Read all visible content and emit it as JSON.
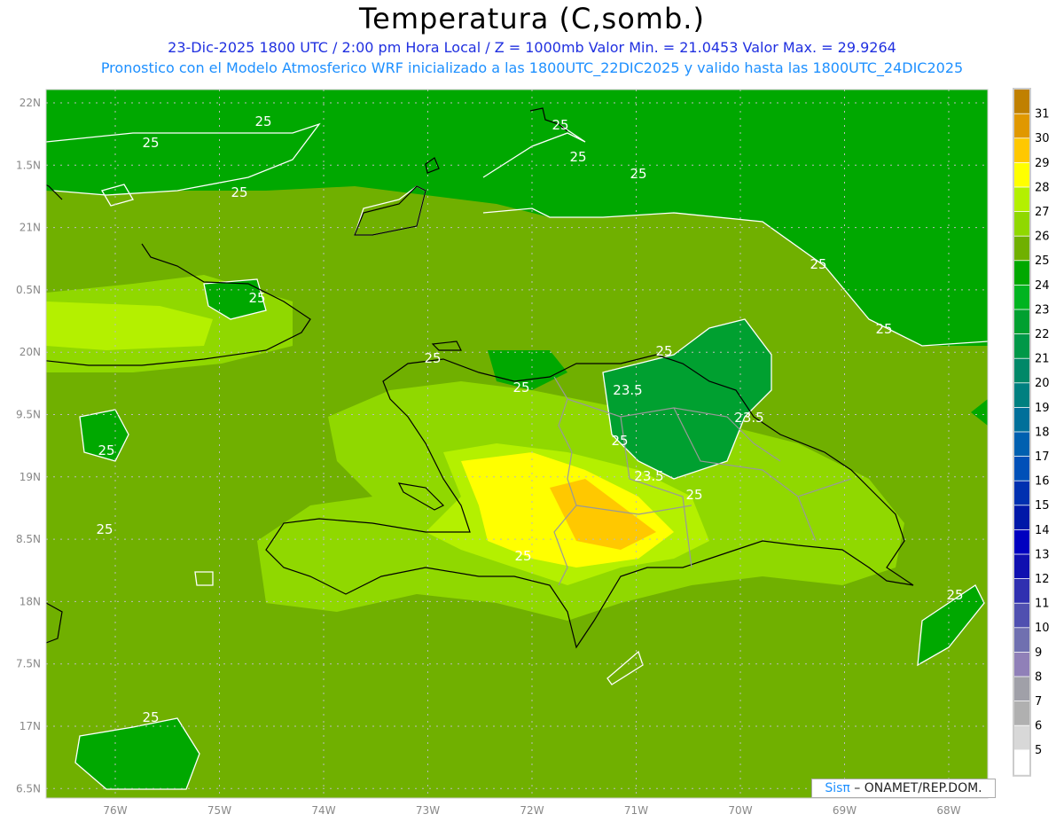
{
  "header": {
    "title": "Temperatura (C,somb.)",
    "subtitle_line1": "23-Dic-2025  1800 UTC / 2:00 pm Hora Local / Z = 1000mb   Valor Min. = 21.0453  Valor Max. = 29.9264",
    "subtitle_line2": "Pronostico con el Modelo Atmosferico WRF inicializado a las 1800UTC_22DIC2025 y valido hasta las  1800UTC_24DIC2025"
  },
  "axes": {
    "lon_labels": [
      "76W",
      "75W",
      "74W",
      "73W",
      "72W",
      "71W",
      "70W",
      "69W",
      "68W"
    ],
    "lat_labels": [
      "22N",
      "1.5N",
      "21N",
      "0.5N",
      "20N",
      "9.5N",
      "19N",
      "8.5N",
      "18N",
      "7.5N",
      "17N",
      "6.5N"
    ]
  },
  "contour_labels": [
    "25",
    "25",
    "25",
    "25",
    "25",
    "25",
    "25",
    "25",
    "25",
    "25",
    "25",
    "25",
    "25",
    "23.5",
    "23.5",
    "23.5",
    "25",
    "25",
    "25",
    "25",
    "25",
    "25"
  ],
  "colorbar": {
    "labels": [
      "31",
      "30",
      "29",
      "28",
      "27",
      "26",
      "25",
      "24",
      "23",
      "22",
      "21",
      "20",
      "19",
      "18",
      "17",
      "16",
      "15",
      "14",
      "13",
      "12",
      "11",
      "10",
      "9",
      "8",
      "7",
      "6",
      "5"
    ],
    "colors": [
      "#c08000",
      "#e09800",
      "#ffc800",
      "#ffff00",
      "#b4f000",
      "#90d800",
      "#70b000",
      "#00a800",
      "#00b420",
      "#00a030",
      "#009848",
      "#008868",
      "#008080",
      "#00709a",
      "#0060b0",
      "#0050b8",
      "#0030b0",
      "#0018a8",
      "#0000c0",
      "#1010b0",
      "#3030b0",
      "#5050b0",
      "#7070b0",
      "#9080b8",
      "#a0a0a8",
      "#b0b0b0",
      "#d8d8d8",
      "#ffffff"
    ]
  },
  "credit": {
    "brand": "Sisπ",
    "text": " – ONAMET/REP.DOM."
  }
}
